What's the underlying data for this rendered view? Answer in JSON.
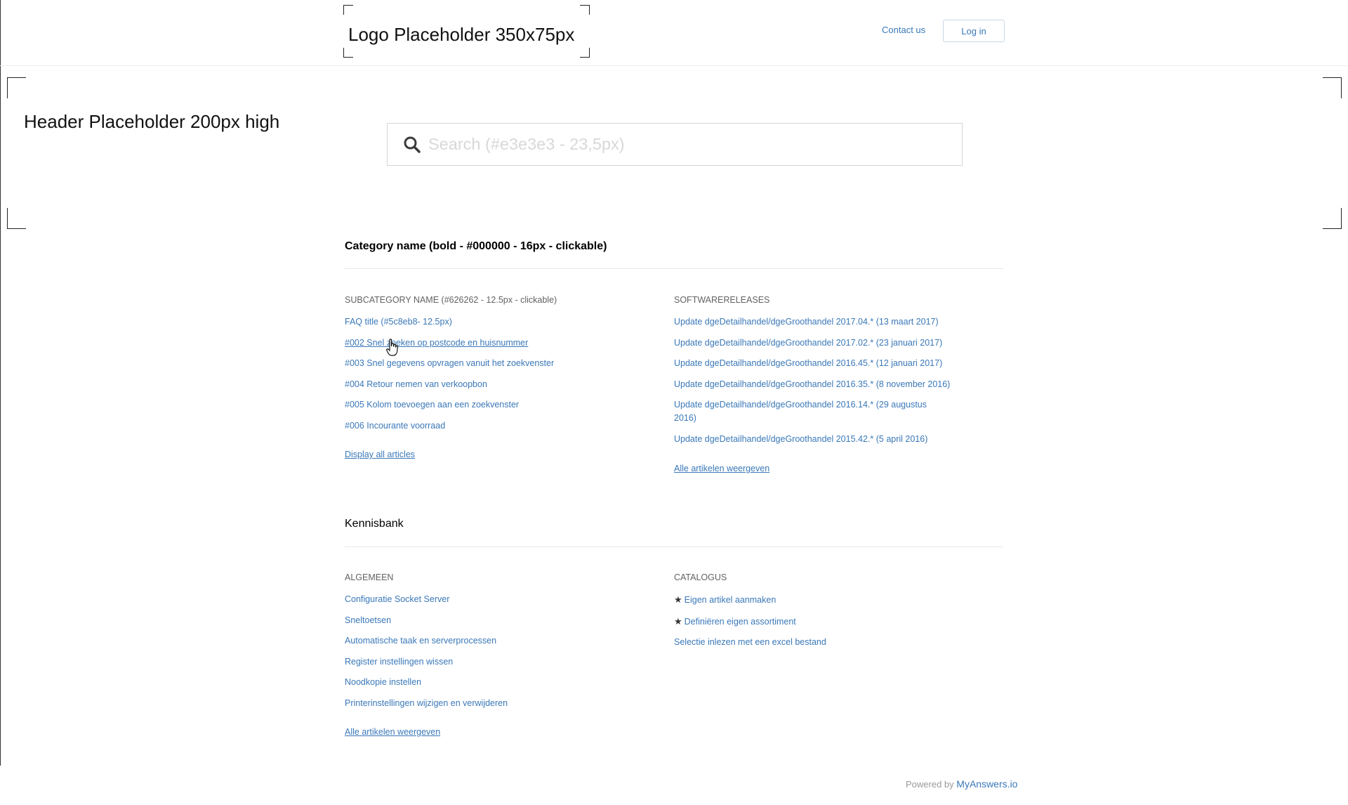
{
  "topbar": {
    "logo_text": "Logo Placeholder 350x75px",
    "contact_label": "Contact us",
    "login_label": "Log in"
  },
  "header": {
    "placeholder_text": "Header Placeholder 200px high",
    "search_placeholder": "Search (#e3e3e3 - 23,5px)",
    "search_icon": "search-icon"
  },
  "categories": [
    {
      "title": "Category name (bold - #000000 - 16px - clickable)",
      "columns": [
        {
          "heading": "SUBCATEGORY NAME (#626262 - 12.5px - clickable)",
          "items": [
            "FAQ title (#5c8eb8- 12.5px)",
            "#002 Snel zoeken op postcode en huisnummer",
            "#003 Snel gegevens opvragen vanuit het zoekvenster",
            "#004 Retour nemen van verkoopbon",
            "#005 Kolom toevoegen aan een zoekvenster",
            "#006 Incourante voorraad"
          ],
          "display_all": "Display all articles"
        },
        {
          "heading": "SOFTWARERELEASES",
          "items": [
            "Update dgeDetailhandel/dgeGroothandel 2017.04.* (13 maart 2017)",
            "Update dgeDetailhandel/dgeGroothandel 2017.02.* (23 januari 2017)",
            "Update dgeDetailhandel/dgeGroothandel 2016.45.* (12 januari 2017)",
            "Update dgeDetailhandel/dgeGroothandel 2016.35.* (8 november 2016)",
            "Update dgeDetailhandel/dgeGroothandel 2016.14.* (29 augustus 2016)",
            "Update dgeDetailhandel/dgeGroothandel 2015.42.* (5 april 2016)"
          ],
          "display_all": "Alle artikelen weergeven"
        }
      ]
    },
    {
      "title": "Kennisbank",
      "columns": [
        {
          "heading": "ALGEMEEN",
          "items": [
            "Configuratie Socket Server",
            "Sneltoetsen",
            "Automatische taak en serverprocessen",
            "Register instellingen wissen",
            "Noodkopie instellen",
            "Printerinstellingen wijzigen en verwijderen"
          ],
          "display_all": "Alle artikelen weergeven"
        },
        {
          "heading": "CATALOGUS",
          "items": [
            "Eigen artikel aanmaken",
            "Definiëren eigen assortiment",
            "Selectie inlezen met een excel bestand"
          ],
          "starred": [
            true,
            true,
            false
          ],
          "star_icon": "star-icon"
        }
      ]
    }
  ],
  "footer": {
    "powered_by": "Powered by",
    "brand": "MyAnswers.io"
  },
  "colors": {
    "link": "#3a78b8",
    "subcategory": "#626262",
    "rule": "#e8e8e8"
  }
}
